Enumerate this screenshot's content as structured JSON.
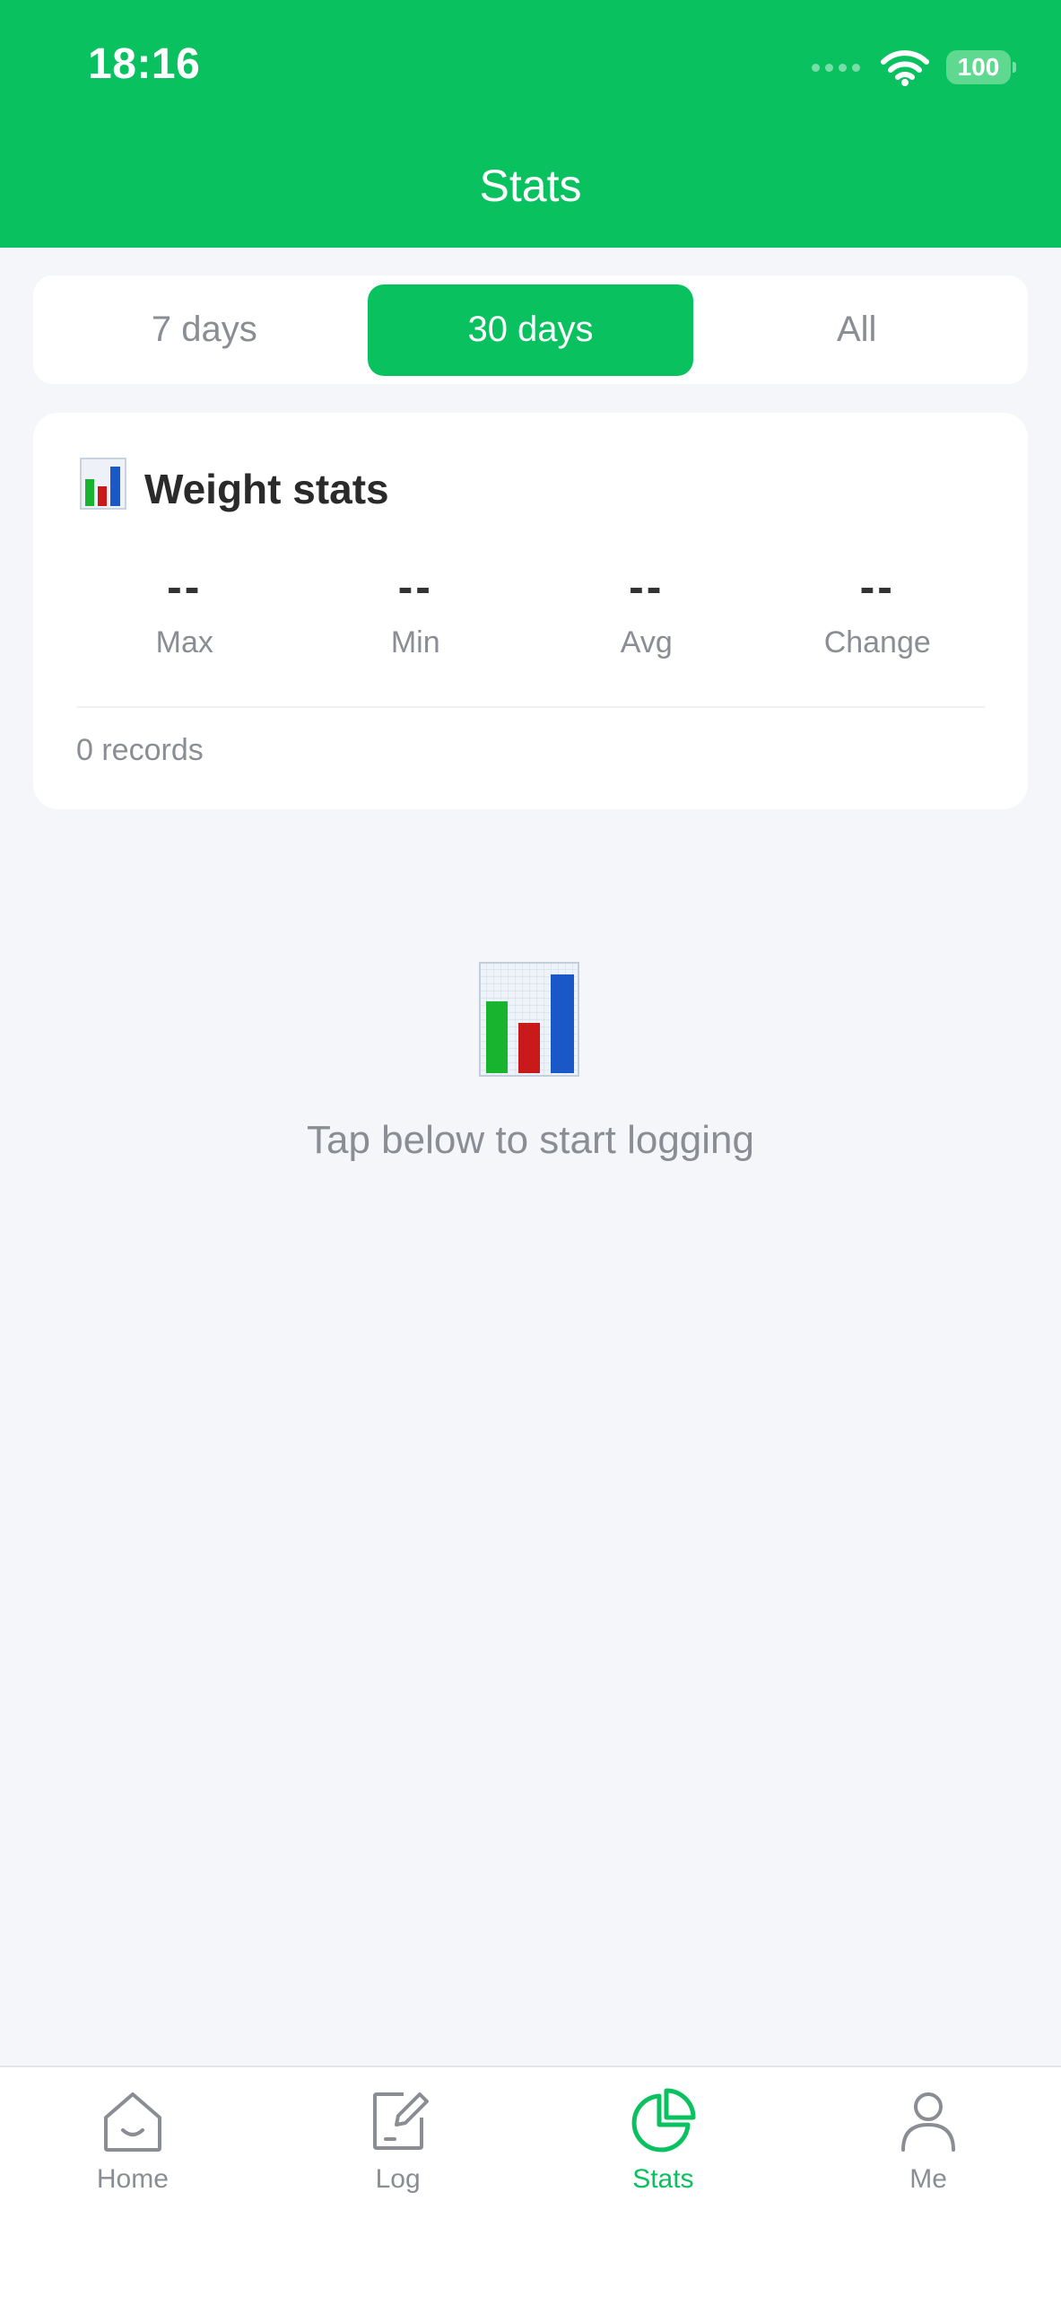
{
  "status_bar": {
    "time": "18:16",
    "battery": "100"
  },
  "header": {
    "title": "Stats"
  },
  "range_tabs": [
    {
      "label": "7 days",
      "active": false
    },
    {
      "label": "30 days",
      "active": true
    },
    {
      "label": "All",
      "active": false
    }
  ],
  "weight_card": {
    "icon": "bar-chart-icon",
    "title": "Weight stats",
    "stats": [
      {
        "value": "--",
        "label": "Max"
      },
      {
        "value": "--",
        "label": "Min"
      },
      {
        "value": "--",
        "label": "Avg"
      },
      {
        "value": "--",
        "label": "Change"
      }
    ],
    "records": "0 records"
  },
  "empty_state": {
    "icon": "bar-chart-icon",
    "message": "Tap below to start logging"
  },
  "tabbar": [
    {
      "label": "Home",
      "icon": "home-icon",
      "active": false
    },
    {
      "label": "Log",
      "icon": "edit-log-icon",
      "active": false
    },
    {
      "label": "Stats",
      "icon": "pie-chart-icon",
      "active": true
    },
    {
      "label": "Me",
      "icon": "person-icon",
      "active": false
    }
  ],
  "colors": {
    "accent": "#0ac15f",
    "background": "#f4f6fa",
    "muted_text": "#8a8d93"
  }
}
